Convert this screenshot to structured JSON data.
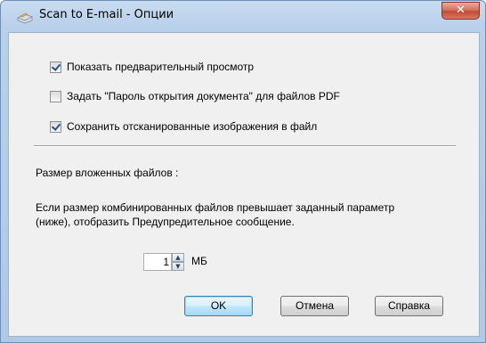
{
  "window": {
    "title": "Scan to E-mail - Опции",
    "close_symbol": "✕",
    "app_icon": "scanner-app-icon"
  },
  "options": {
    "show_preview": {
      "label": "Показать предварительный просмотр",
      "checked": true
    },
    "set_pdf_password": {
      "label": "Задать \"Пароль открытия документа\" для файлов PDF",
      "checked": false
    },
    "save_to_file": {
      "label": "Сохранить отсканированные изображения в файл",
      "checked": true
    }
  },
  "attachment_size": {
    "heading": "Размер вложенных файлов :",
    "description_line1": "Если размер комбинированных файлов превышает заданный параметр",
    "description_line2": "(ниже), отобразить Предупредительное сообщение.",
    "value": "1",
    "unit": "МБ"
  },
  "buttons": {
    "ok": "OK",
    "cancel": "Отмена",
    "help": "Справка"
  }
}
